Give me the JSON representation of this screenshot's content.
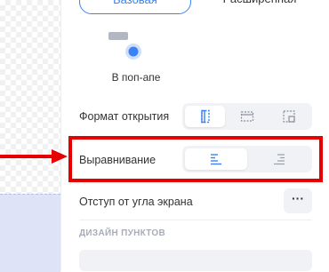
{
  "tabs": {
    "basic_label": "Базовая",
    "extended_label": "Расширенная"
  },
  "popup_option": {
    "label": "В поп-апе"
  },
  "open_format": {
    "label": "Формат открытия",
    "options": [
      "vertical-panel-icon",
      "horizontal-panel-icon",
      "corner-panel-icon"
    ],
    "selected": 0
  },
  "alignment": {
    "label": "Выравнивание",
    "options": [
      "align-left-icon",
      "align-right-icon"
    ],
    "selected": 0
  },
  "corner_offset": {
    "label": "Отступ от угла экрана",
    "button_label": "···"
  },
  "items_design": {
    "section_title": "ДИЗАЙН ПУНКТОВ"
  },
  "colors": {
    "accent": "#3b82f6",
    "highlight": "#e60000",
    "segment_bg": "#f1f2f5"
  }
}
